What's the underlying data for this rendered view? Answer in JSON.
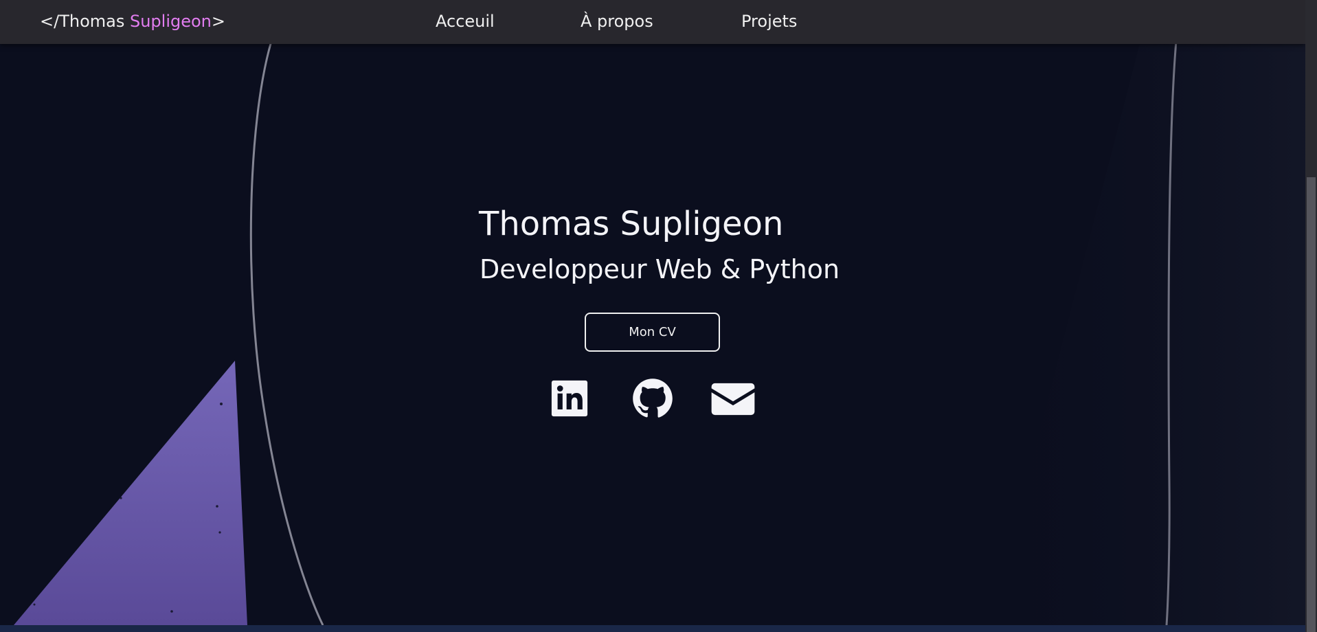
{
  "navbar": {
    "brand_prefix": "</",
    "brand_first": "Thomas ",
    "brand_accent": "Supligeon",
    "brand_suffix": ">",
    "links": [
      {
        "label": "Acceuil"
      },
      {
        "label": "À propos"
      },
      {
        "label": "Projets"
      }
    ],
    "icons": [
      "linkedin-icon",
      "github-icon",
      "mail-icon"
    ]
  },
  "hero": {
    "title": "Thomas Supligeon",
    "subtitle": "Developpeur Web & Python",
    "cv_button": "Mon CV",
    "icons": [
      "linkedin-icon",
      "github-icon",
      "mail-icon"
    ]
  },
  "colors": {
    "background": "#0b0e1e",
    "navbar": "#28272d",
    "accent": "#e27df0",
    "text": "#f2f2f5",
    "purple_shape": "#6a5aa8"
  }
}
